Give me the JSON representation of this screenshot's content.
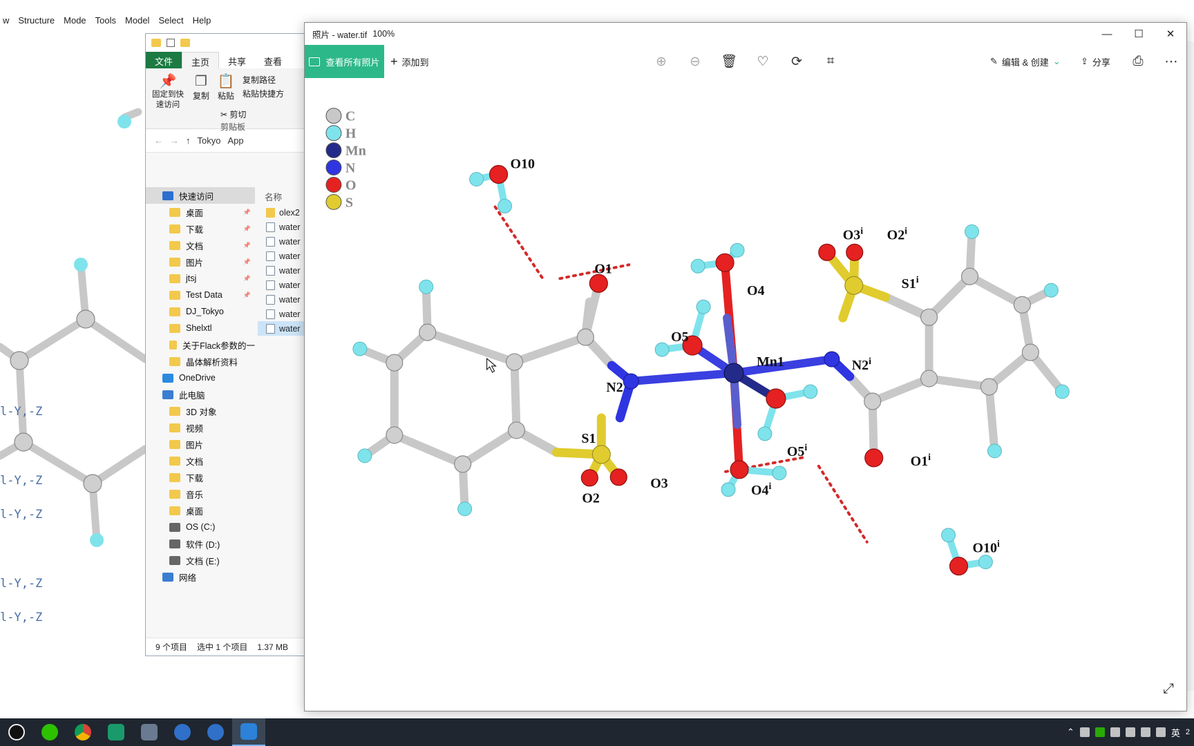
{
  "olex": {
    "menu": [
      "w",
      "Structure",
      "Mode",
      "Tools",
      "Model",
      "Select",
      "Help"
    ],
    "sym_labels": [
      "l-Y,-Z",
      "l-Y,-Z",
      "l-Y,-Z",
      "l-Y,-Z",
      "l-Y,-Z"
    ]
  },
  "explorer": {
    "ribbon_tabs": [
      "文件",
      "主页",
      "共享",
      "查看"
    ],
    "ribbon": {
      "pin_label": "固定到快速访问",
      "copy_label": "复制",
      "paste_label": "粘贴",
      "copy_path_label": "复制路径",
      "paste_shortcut_label": "粘贴快捷方",
      "cut_label": "剪切",
      "clipboard_group": "剪贴板"
    },
    "address": [
      "Tokyo",
      "App"
    ],
    "column_name": "名称",
    "nav": [
      {
        "label": "快速访问",
        "type": "group",
        "selected": true
      },
      {
        "label": "桌面",
        "pinned": true
      },
      {
        "label": "下载",
        "pinned": true
      },
      {
        "label": "文档",
        "pinned": true
      },
      {
        "label": "图片",
        "pinned": true
      },
      {
        "label": "jtsj",
        "pinned": true
      },
      {
        "label": "Test Data",
        "pinned": true
      },
      {
        "label": "DJ_Tokyo"
      },
      {
        "label": "Shelxtl"
      },
      {
        "label": "关于Flack参数的一"
      },
      {
        "label": "晶体解析资料"
      },
      {
        "label": "OneDrive",
        "type": "group"
      },
      {
        "label": "此电脑",
        "type": "group"
      },
      {
        "label": "3D 对象"
      },
      {
        "label": "视频"
      },
      {
        "label": "图片"
      },
      {
        "label": "文档"
      },
      {
        "label": "下载"
      },
      {
        "label": "音乐"
      },
      {
        "label": "桌面"
      },
      {
        "label": "OS (C:)"
      },
      {
        "label": "软件 (D:)"
      },
      {
        "label": "文档 (E:)"
      },
      {
        "label": "网络",
        "type": "group"
      }
    ],
    "files": [
      {
        "name": "olex2",
        "kind": "folder"
      },
      {
        "name": "water",
        "kind": "file"
      },
      {
        "name": "water",
        "kind": "file"
      },
      {
        "name": "water",
        "kind": "file"
      },
      {
        "name": "water",
        "kind": "file"
      },
      {
        "name": "water",
        "kind": "file"
      },
      {
        "name": "water",
        "kind": "file"
      },
      {
        "name": "water",
        "kind": "file"
      },
      {
        "name": "water",
        "kind": "file",
        "selected": true
      }
    ],
    "status": {
      "count": "9 个项目",
      "selected": "选中 1 个项目",
      "size": "1.37 MB"
    }
  },
  "photos": {
    "title": "照片 - water.tif",
    "zoom": "100%",
    "toolbar": {
      "see_all": "查看所有照片",
      "add_to": "添加到",
      "edit_create": "编辑 & 创建",
      "share": "分享"
    },
    "legend": [
      {
        "sym": "C",
        "color": "#c8c8c8"
      },
      {
        "sym": "H",
        "color": "#7fe3ec"
      },
      {
        "sym": "Mn",
        "color": "#232a8a"
      },
      {
        "sym": "N",
        "color": "#2f35e0"
      },
      {
        "sym": "O",
        "color": "#e52121"
      },
      {
        "sym": "S",
        "color": "#e0cc2e"
      }
    ],
    "atoms": {
      "O10": "O10",
      "O1": "O1",
      "O4": "O4",
      "O5": "O5",
      "Mn1": "Mn1",
      "N2": "N2",
      "S1": "S1",
      "O2": "O2",
      "O3": "O3",
      "O3i": "O3",
      "O2i": "O2",
      "S1i": "S1",
      "N2i": "N2",
      "O5i": "O5",
      "O1i": "O1",
      "O4i": "O4",
      "O10i": "O10",
      "sup": "i"
    }
  },
  "taskbar": {
    "ime": "英",
    "clock": "2"
  }
}
